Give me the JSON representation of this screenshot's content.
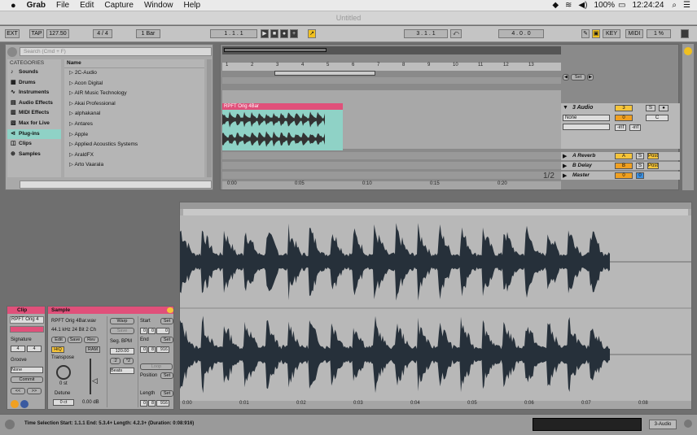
{
  "menubar": {
    "apple": "",
    "items": [
      "Grab",
      "File",
      "Edit",
      "Capture",
      "Window",
      "Help"
    ],
    "battery": "100%",
    "time": "12:24:24"
  },
  "window": {
    "title": "Untitled"
  },
  "toolbar": {
    "ext": "EXT",
    "tap": "TAP",
    "tempo": "127.50",
    "signature": "4 / 4",
    "quant": "1 Bar",
    "position": "1 .  1 .  1",
    "loop_start": "3 .  1 .  1",
    "loop_len": "4 .  0 .  0",
    "key": "KEY",
    "midi": "MIDI",
    "cpu": "1 %"
  },
  "browser": {
    "search_placeholder": "Search (Cmd + F)",
    "categories_label": "CATEGORIES",
    "name_header": "Name",
    "categories": [
      {
        "label": "Sounds",
        "icon": "♪"
      },
      {
        "label": "Drums",
        "icon": "▦"
      },
      {
        "label": "Instruments",
        "icon": "∿"
      },
      {
        "label": "Audio Effects",
        "icon": "▤"
      },
      {
        "label": "MIDI Effects",
        "icon": "▥"
      },
      {
        "label": "Max for Live",
        "icon": "▧"
      },
      {
        "label": "Plug-ins",
        "icon": "⊲"
      },
      {
        "label": "Clips",
        "icon": "◫"
      },
      {
        "label": "Samples",
        "icon": "⊕"
      }
    ],
    "selected_category": "Plug-ins",
    "items": [
      "2C-Audio",
      "Acon Digital",
      "AIR Music Technology",
      "Akai Professional",
      "alphakanal",
      "Antares",
      "Apple",
      "Applied Acoustics Systems",
      "AraldFX",
      "Arto Vaarala"
    ]
  },
  "arrangement": {
    "bar_numbers": [
      "1",
      "2",
      "3",
      "4",
      "5",
      "6",
      "7",
      "8",
      "9",
      "10",
      "11",
      "12",
      "13"
    ],
    "time_marks": [
      "0:00",
      "0:05",
      "0:10",
      "0:15",
      "0:20"
    ],
    "set_label": "Set",
    "zoom": "1/2",
    "clip_name": "RPFT Orig 4Bar",
    "tracks": [
      {
        "name": "3 Audio",
        "num": "3",
        "s": "S",
        "input": "None",
        "mon": "0",
        "ch": "C",
        "vol1": "-inf",
        "vol2": "-inf"
      },
      {
        "name": "A Reverb",
        "num": "A",
        "s": "S",
        "post": "Post"
      },
      {
        "name": "B Delay",
        "num": "B",
        "s": "S",
        "post": "Post"
      },
      {
        "name": "Master",
        "num": "0",
        "s": "0"
      }
    ]
  },
  "clip_view": {
    "clip_tab": "Clip",
    "clip_name": "RPFT Orig 4",
    "signature_label": "Signature",
    "sig_num": "4",
    "sig_den": "4",
    "groove_label": "Groove",
    "groove_value": "None",
    "commit": "Commit",
    "sample_tab": "Sample",
    "file": "RPFT Orig 4Bar.wav",
    "format": "44.1 kHz 24 Bit 2 Ch",
    "edit": "Edit",
    "save": "Save",
    "rev": "Rev",
    "hiq": "HiQ",
    "ram": "RAM",
    "warp": "Warp",
    "save2": "Save",
    "seg_bpm_label": "Seg. BPM",
    "seg_bpm": "120.00",
    "beats": "Beats",
    "transpose_label": "Transpose",
    "transpose": "0 st",
    "detune_label": "Detune",
    "detune": "0 ct",
    "gain": "0.00 dB",
    "start_label": "Start",
    "start": [
      "0",
      "0",
      "0"
    ],
    "end_label": "End",
    "end": [
      "0",
      "8",
      "916"
    ],
    "loop": "Loop",
    "position_label": "Position",
    "length_label": "Length",
    "length": [
      "0",
      "8",
      "916"
    ],
    "set": "Set"
  },
  "sample_editor": {
    "ticks": [
      "0:00",
      "0:01",
      "0:02",
      "0:03",
      "0:04",
      "0:05",
      "0:06",
      "0:07",
      "0:08"
    ]
  },
  "status": {
    "text": "Time Selection    Start: 1.1.1    End: 5.3.4+    Length: 4.2.3+  (Duration: 0:08:916)",
    "track": "3-Audio"
  },
  "colors": {
    "clip": "#e0507a",
    "audio_bg": "#8fd2c6",
    "orange": "#f0a020",
    "yellow": "#f5c43a",
    "blue": "#3a8fe0"
  }
}
